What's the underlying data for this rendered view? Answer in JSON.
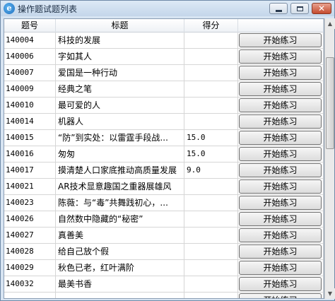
{
  "window": {
    "title": "操作题试题列表",
    "icon": "app-logo-icon",
    "app_icon_glyph": "e"
  },
  "controls": {
    "close_glyph": "✕"
  },
  "table": {
    "columns": [
      "题号",
      "标题",
      "得分",
      ""
    ],
    "action_label": "开始练习",
    "rows": [
      {
        "id": "140004",
        "title": "科技的发展",
        "score": ""
      },
      {
        "id": "140006",
        "title": "字如其人",
        "score": ""
      },
      {
        "id": "140007",
        "title": "爱国是一种行动",
        "score": ""
      },
      {
        "id": "140009",
        "title": "经典之笔",
        "score": ""
      },
      {
        "id": "140010",
        "title": "最可爱的人",
        "score": ""
      },
      {
        "id": "140014",
        "title": "机器人",
        "score": ""
      },
      {
        "id": "140015",
        "title": "“防”到实处：以雷霆手段战...",
        "score": "15.0"
      },
      {
        "id": "140016",
        "title": "匆匆",
        "score": "15.0"
      },
      {
        "id": "140017",
        "title": "摸清楚人口家底推动高质量发展",
        "score": "9.0"
      },
      {
        "id": "140021",
        "title": "AR技术显意趣国之重器展雄风",
        "score": ""
      },
      {
        "id": "140023",
        "title": "陈薇：与“毒”共舞践初心，...",
        "score": ""
      },
      {
        "id": "140026",
        "title": "自然数中隐藏的“秘密”",
        "score": ""
      },
      {
        "id": "140027",
        "title": "真善美",
        "score": ""
      },
      {
        "id": "140028",
        "title": "给自己放个假",
        "score": ""
      },
      {
        "id": "140029",
        "title": "秋色已老，红叶满阶",
        "score": ""
      },
      {
        "id": "140032",
        "title": "最美书香",
        "score": ""
      },
      {
        "id": "",
        "title": "",
        "score": ""
      }
    ]
  },
  "scrollbar": {
    "up_glyph": "▲",
    "down_glyph": "▼"
  }
}
